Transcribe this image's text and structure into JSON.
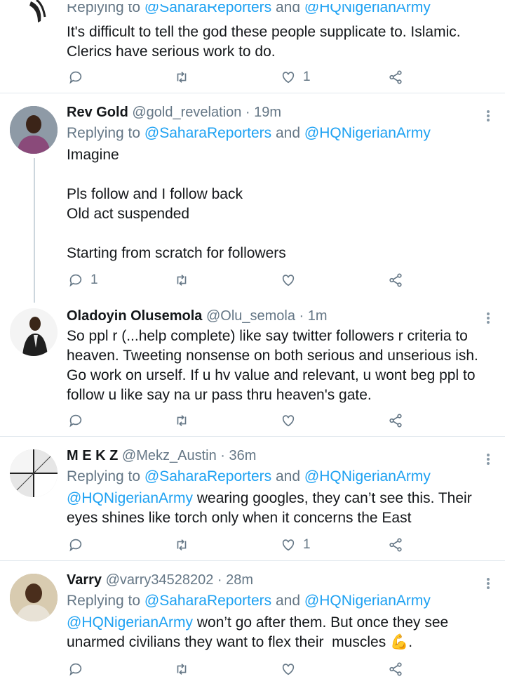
{
  "tweets": [
    {
      "reply_prefix": "Replying to",
      "reply_to_1": "@SaharaReporters",
      "reply_and": "and",
      "reply_to_2": "@HQNigerianArmy",
      "text": "It's difficult to tell the god these people supplicate to. Islamic.\nClerics have serious work to do.",
      "reply_count": "",
      "retweet_count": "",
      "like_count": "1"
    },
    {
      "name": "Rev Gold",
      "handle": "@gold_revelation",
      "time": "· 19m",
      "reply_prefix": "Replying to",
      "reply_to_1": "@SaharaReporters",
      "reply_and": "and",
      "reply_to_2": "@HQNigerianArmy",
      "text": "Imagine\n\nPls follow and I follow back\nOld act suspended\n\nStarting from scratch for followers",
      "reply_count": "1",
      "retweet_count": "",
      "like_count": ""
    },
    {
      "name": "Oladoyin Olusemola",
      "handle": "@Olu_semola",
      "time": "· 1m",
      "text": "So ppl r (...help complete) like say twitter followers r criteria to\nheaven. Tweeting nonsense on both serious and unserious ish.\nGo work on urself. If u hv value and relevant, u wont beg ppl to\nfollow u like say na ur pass thru heaven's gate.",
      "reply_count": "",
      "retweet_count": "",
      "like_count": ""
    },
    {
      "name": "M E K Z",
      "handle": "@Mekz_Austin",
      "time": "· 36m",
      "reply_prefix": "Replying to",
      "reply_to_1": "@SaharaReporters",
      "reply_and": "and",
      "reply_to_2": "@HQNigerianArmy",
      "text_mention": "@HQNigerianArmy",
      "text_rest": " wearing googles, they can’t see this. Their\neyes shines like torch only when it concerns the East",
      "reply_count": "",
      "retweet_count": "",
      "like_count": "1"
    },
    {
      "name": "Varry",
      "handle": "@varry34528202",
      "time": "· 28m",
      "reply_prefix": "Replying to",
      "reply_to_1": "@SaharaReporters",
      "reply_and": "and",
      "reply_to_2": "@HQNigerianArmy",
      "text_mention": "@HQNigerianArmy",
      "text_rest": " won’t go after them. But once they see\nunarmed civilians they want to flex their  muscles ",
      "emoji": "💪",
      "text_end": "."
    }
  ],
  "colors": {
    "accent": "#1da1f2",
    "secondary_text": "#657786",
    "divider": "#e1e8ed"
  },
  "icons": [
    "reply-icon",
    "retweet-icon",
    "like-icon",
    "share-icon",
    "more-icon"
  ]
}
